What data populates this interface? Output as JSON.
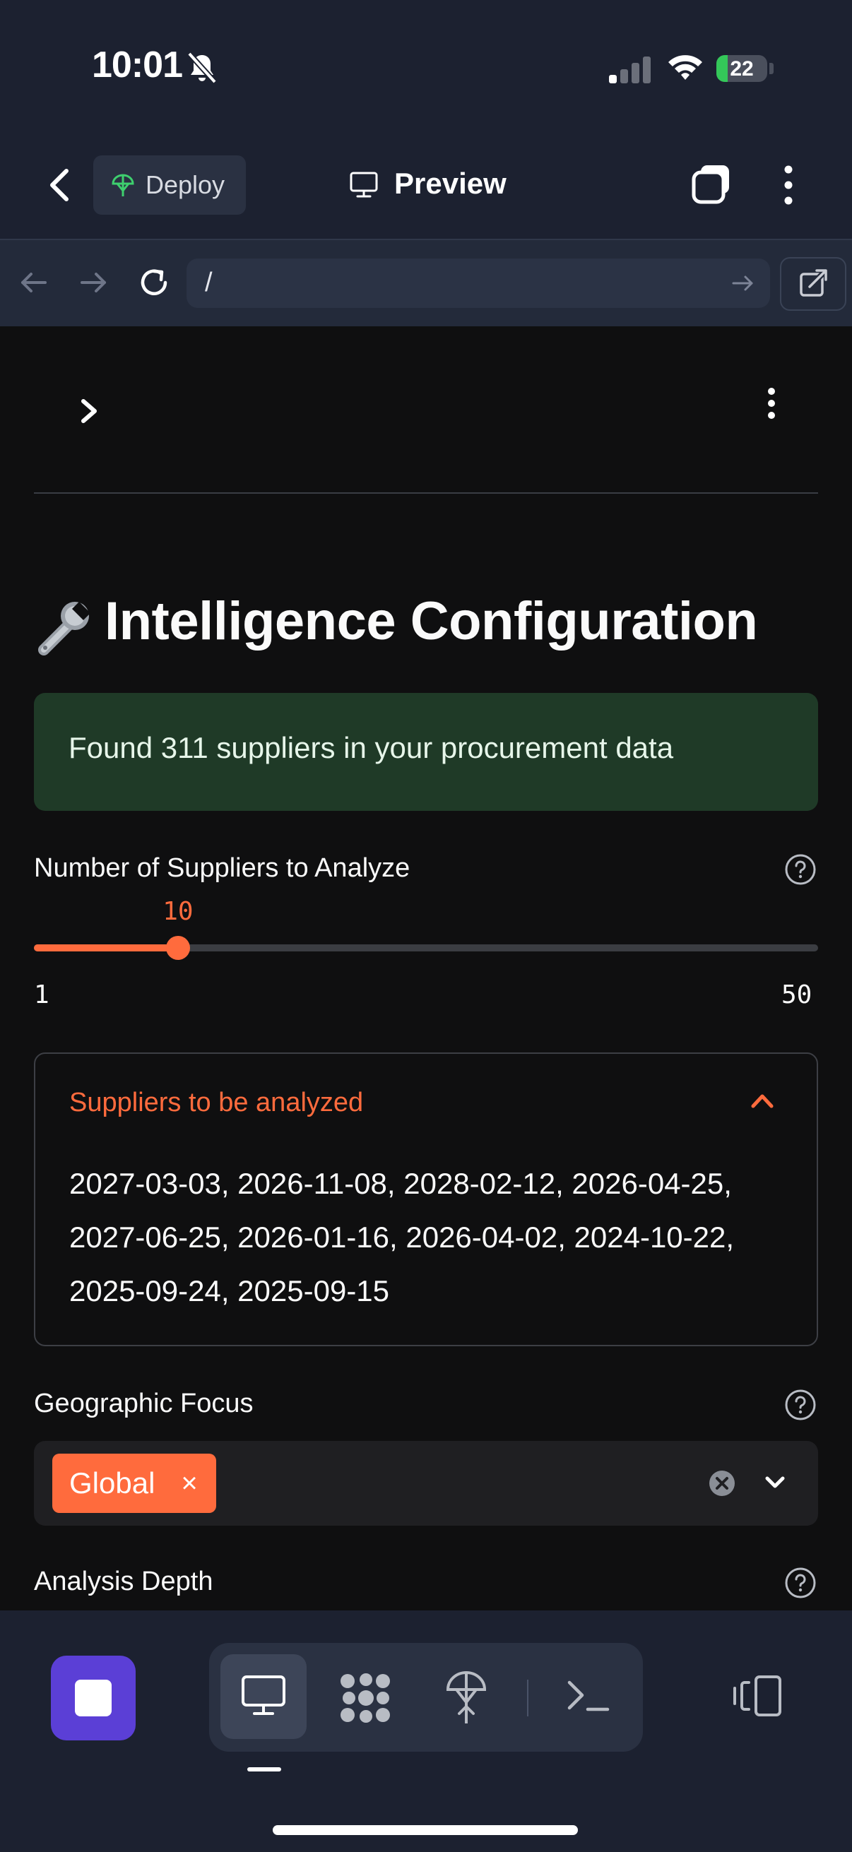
{
  "status_bar": {
    "time": "10:01",
    "battery": "22",
    "battery_level": 0.22
  },
  "toolbar": {
    "deploy_label": "Deploy",
    "preview_label": "Preview"
  },
  "browser": {
    "url": "/"
  },
  "app": {
    "title": "Intelligence Configuration",
    "success_message": "Found 311 suppliers in your procurement data",
    "slider": {
      "label": "Number of Suppliers to Analyze",
      "value": "10",
      "min": "1",
      "max": "50"
    },
    "expander": {
      "title": "Suppliers to be analyzed",
      "content": "2027-03-03, 2026-11-08, 2028-02-12, 2026-04-25, 2027-06-25, 2026-01-16, 2026-04-02, 2024-10-22, 2025-09-24, 2025-09-15"
    },
    "geographic_focus": {
      "label": "Geographic Focus",
      "selected": "Global",
      "remove_symbol": "×"
    },
    "analysis_depth": {
      "label": "Analysis Depth"
    }
  },
  "colors": {
    "accent": "#ff6b3d",
    "success_bg": "#1f3a27",
    "app_bg": "#0f0f10",
    "chrome_bg": "#1c2130",
    "stop_button": "#5b3fd6"
  },
  "icons": [
    "bell-slash-icon",
    "signal-icon",
    "wifi-icon",
    "battery-icon",
    "chevron-left-icon",
    "deploy-icon",
    "monitor-icon",
    "tabs-icon",
    "more-vertical-icon",
    "arrow-left-icon",
    "arrow-right-icon",
    "reload-icon",
    "external-link-icon",
    "chevron-right-icon",
    "wrench-icon",
    "help-circle-icon",
    "chevron-up-icon",
    "clear-circle-icon",
    "chevron-down-icon",
    "stop-icon",
    "apps-icon",
    "terminal-icon",
    "split-view-icon"
  ]
}
